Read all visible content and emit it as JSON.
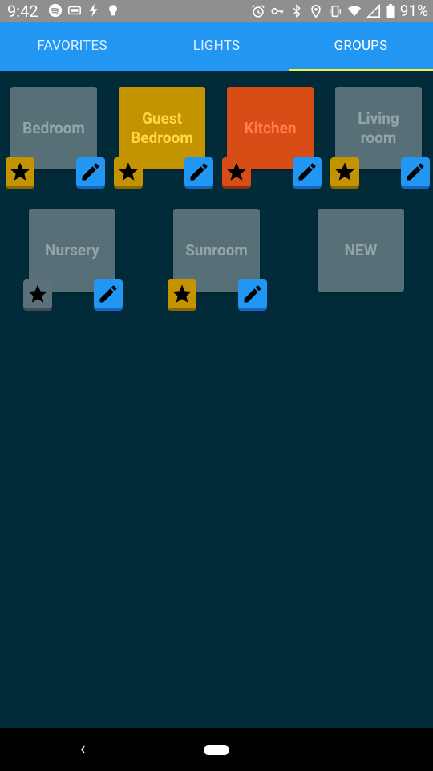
{
  "status_bar": {
    "time": "9:42",
    "battery_percent": "91%",
    "left_icons": [
      "spotify-icon",
      "cast-icon",
      "flash-icon",
      "bulb-icon"
    ],
    "right_icons": [
      "alarm-icon",
      "vpn-key-icon",
      "bluetooth-icon",
      "location-icon",
      "vibrate-icon",
      "wifi-icon",
      "signal-icon",
      "battery-icon"
    ]
  },
  "tabs": [
    {
      "label": "FAVORITES",
      "active": false
    },
    {
      "label": "LIGHTS",
      "active": false
    },
    {
      "label": "GROUPS",
      "active": true
    }
  ],
  "groups": [
    {
      "name": "Bedroom",
      "color": "gray",
      "favorite": true
    },
    {
      "name": "Guest Bedroom",
      "color": "yellow",
      "favorite": true
    },
    {
      "name": "Kitchen",
      "color": "orange",
      "favorite": true
    },
    {
      "name": "Living room",
      "color": "gray",
      "favorite": true
    },
    {
      "name": "Nursery",
      "color": "gray",
      "favorite": false
    },
    {
      "name": "Sunroom",
      "color": "gray",
      "favorite": true
    }
  ],
  "new_tile_label": "NEW",
  "colors": {
    "background": "#022b3a",
    "tabbar": "#2196f3",
    "tab_indicator": "#ffeb3b",
    "tile_off": "#577078",
    "tile_yellow": "#c49300",
    "tile_orange": "#d84c16"
  }
}
